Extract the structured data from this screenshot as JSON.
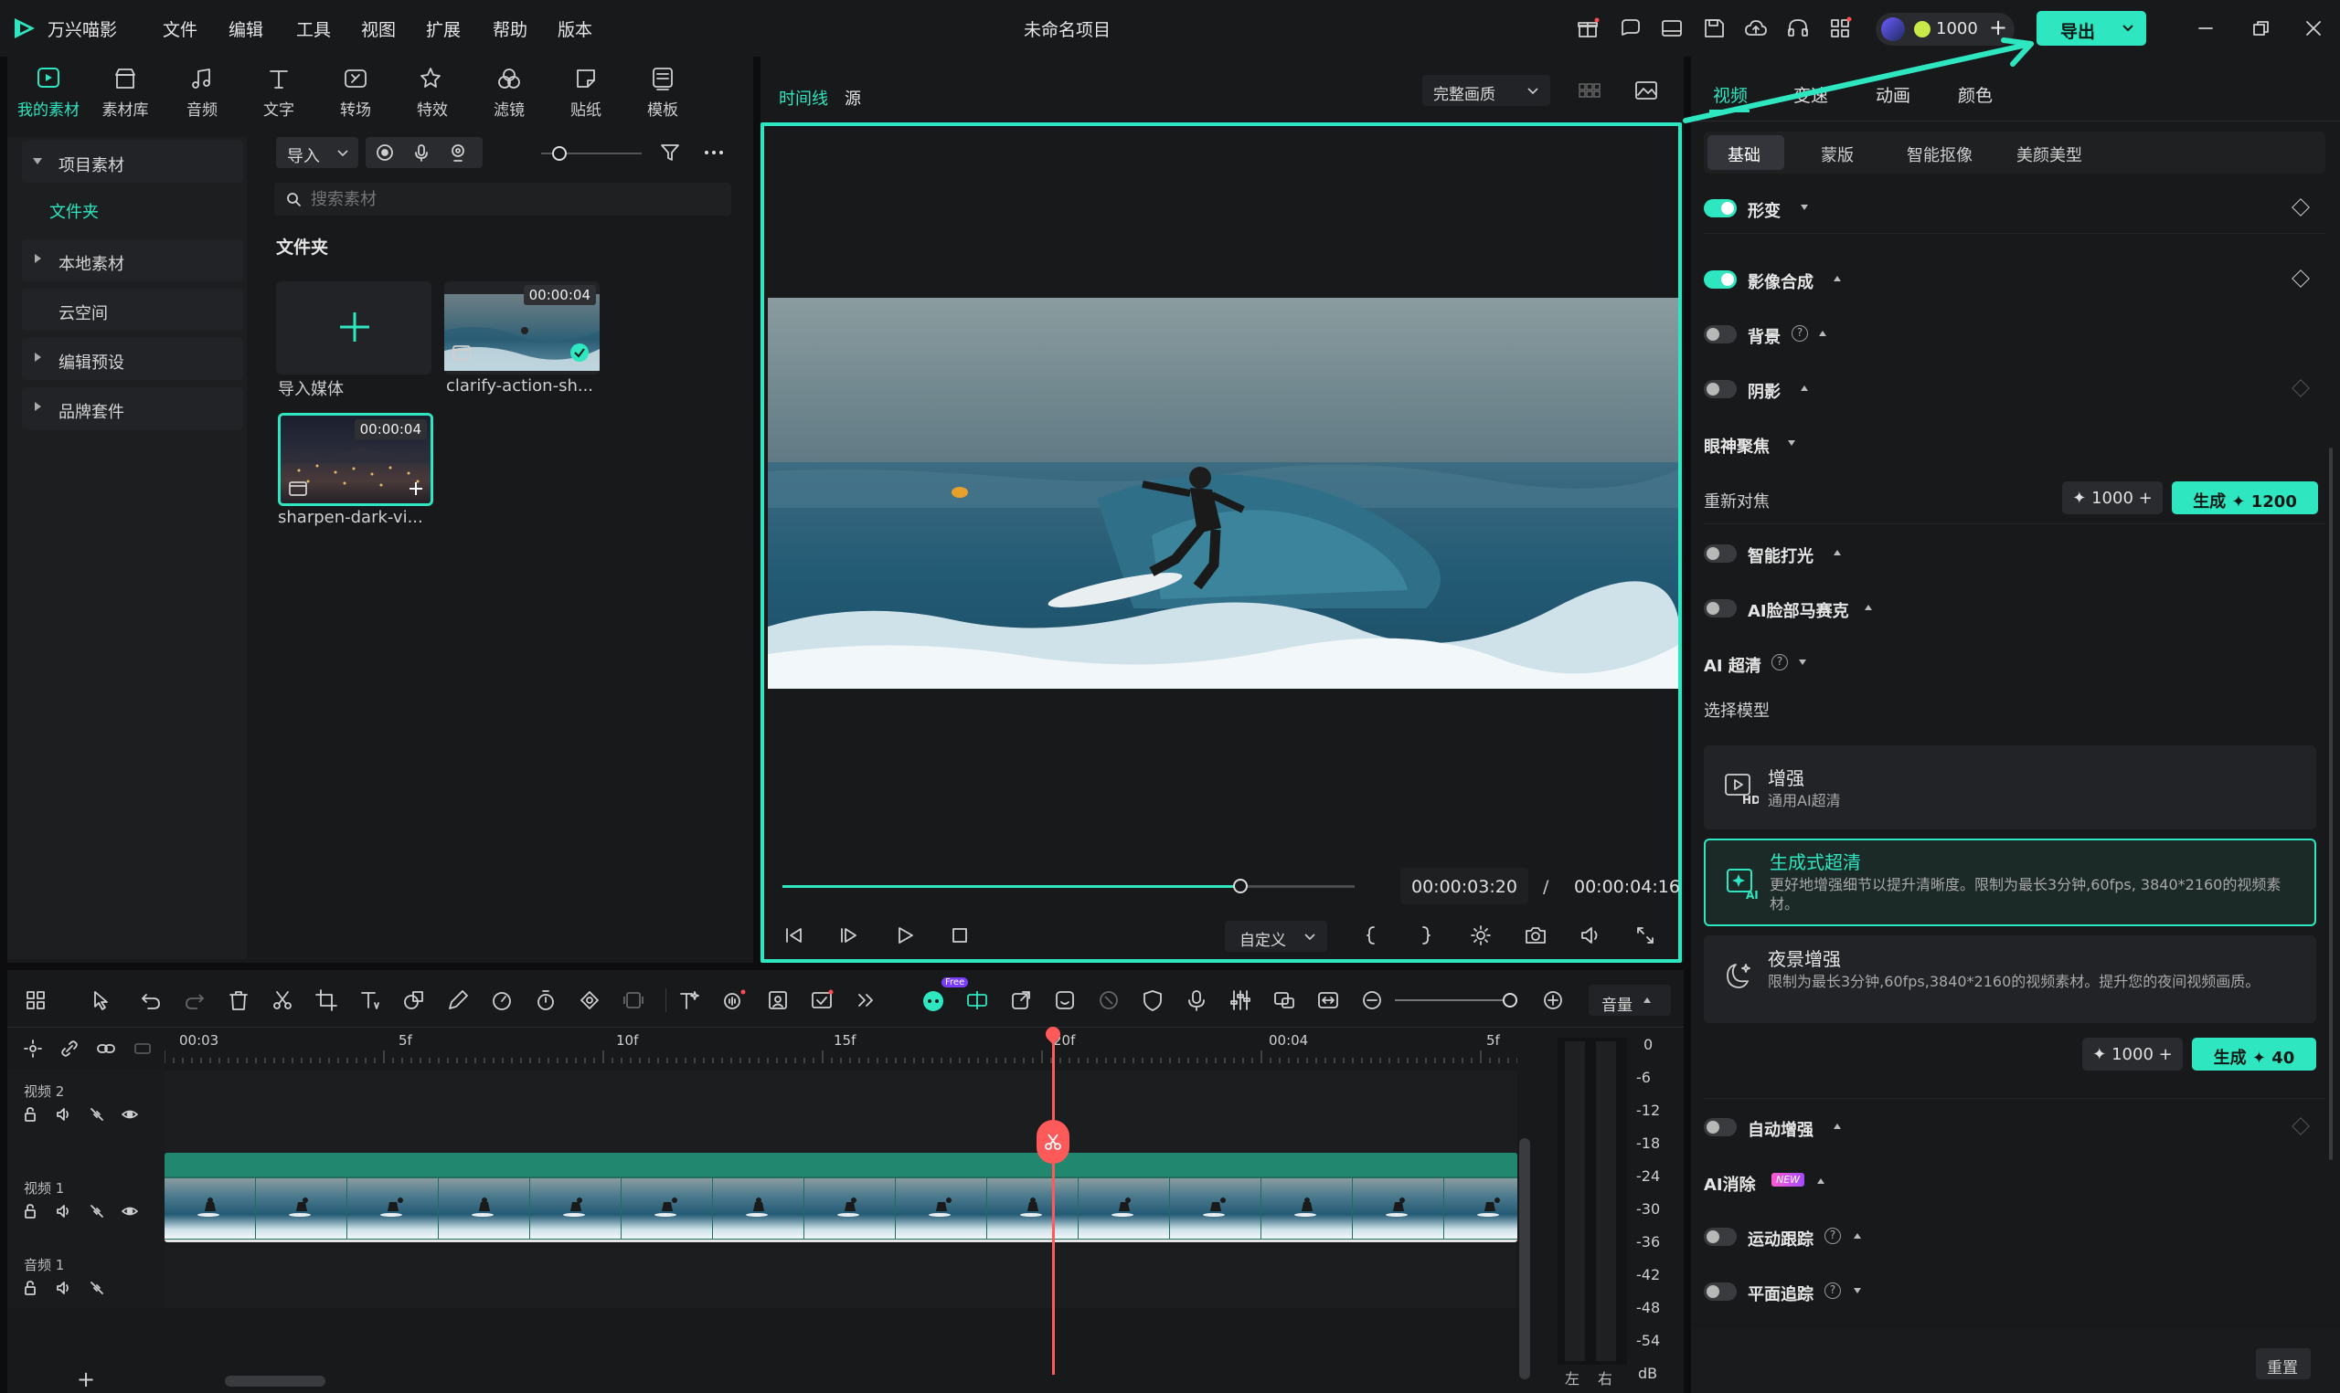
{
  "app": {
    "name": "万兴喵影",
    "project_title": "未命名项目"
  },
  "menu": [
    "文件",
    "编辑",
    "工具",
    "视图",
    "扩展",
    "帮助",
    "版本"
  ],
  "titlebar": {
    "credits": "1000",
    "export_label": "导出"
  },
  "toolbar_tabs": [
    {
      "label": "我的素材",
      "icon": "media-icon"
    },
    {
      "label": "素材库",
      "icon": "store-icon"
    },
    {
      "label": "音频",
      "icon": "music-icon"
    },
    {
      "label": "文字",
      "icon": "text-icon"
    },
    {
      "label": "转场",
      "icon": "transition-icon"
    },
    {
      "label": "特效",
      "icon": "effects-icon"
    },
    {
      "label": "滤镜",
      "icon": "filter-icon"
    },
    {
      "label": "贴纸",
      "icon": "sticker-icon"
    },
    {
      "label": "模板",
      "icon": "template-icon"
    }
  ],
  "media_tree": {
    "project_media": "项目素材",
    "folder": "文件夹",
    "local_media": "本地素材",
    "cloud": "云空间",
    "edit_presets": "编辑预设",
    "brand_kit": "品牌套件"
  },
  "media_toolbar": {
    "import": "导入",
    "search_placeholder": "搜索素材",
    "folder_title": "文件夹"
  },
  "media_items": [
    {
      "label": "导入媒体"
    },
    {
      "label": "clarify-action-sh...",
      "duration": "00:00:04"
    },
    {
      "label": "sharpen-dark-vi...",
      "duration": "00:00:04"
    }
  ],
  "preview": {
    "tab_timeline": "时间线",
    "tab_source": "源",
    "quality": "完整画质",
    "current_time": "00:00:03:20",
    "separator": "/",
    "total_time": "00:00:04:16",
    "zoom": "自定义",
    "progress": 0.8
  },
  "props": {
    "tabs": [
      "视频",
      "变速",
      "动画",
      "颜色"
    ],
    "sub_tabs": [
      "基础",
      "蒙版",
      "智能抠像",
      "美颜美型"
    ],
    "transform": "形变",
    "compositing": "影像合成",
    "background": "背景",
    "shadow": "阴影",
    "eye_focus": "眼神聚焦",
    "refocus": "重新对焦",
    "refocus_credits": "1000",
    "refocus_gen": "生成",
    "refocus_cost": "1200",
    "smart_light": "智能打光",
    "face_mosaic": "AI脸部马赛克",
    "ai_sr": "AI 超清",
    "choose_model": "选择模型",
    "models": [
      {
        "title": "增强",
        "desc": "通用AI超清"
      },
      {
        "title": "生成式超清",
        "desc": "更好地增强细节以提升清晰度。限制为最长3分钟,60fps, 3840*2160的视频素材。"
      },
      {
        "title": "夜景增强",
        "desc": "限制为最长3分钟,60fps,3840*2160的视频素材。提升您的夜间视频画质。"
      }
    ],
    "sr_credits": "1000",
    "sr_gen": "生成",
    "sr_cost": "40",
    "auto_enhance": "自动增强",
    "ai_remove": "AI消除",
    "new_badge": "NEW",
    "motion_track": "运动跟踪",
    "planar_track": "平面追踪",
    "reset": "重置"
  },
  "timeline": {
    "ruler": [
      "00:03",
      "5f",
      "10f",
      "15f",
      "20f",
      "00:04",
      "5f"
    ],
    "tracks": [
      "视频 2",
      "视频 1",
      "音频 1"
    ],
    "volume_label": "音量",
    "db_scale": [
      "0",
      "-6",
      "-12",
      "-18",
      "-24",
      "-30",
      "-36",
      "-42",
      "-48",
      "-54",
      "dB"
    ],
    "left": "左",
    "right": "右",
    "free_badge": "Free",
    "add": "+"
  },
  "colors": {
    "accent": "#2ee6c0",
    "playhead": "#ff5a5a",
    "panel": "#18191b"
  }
}
